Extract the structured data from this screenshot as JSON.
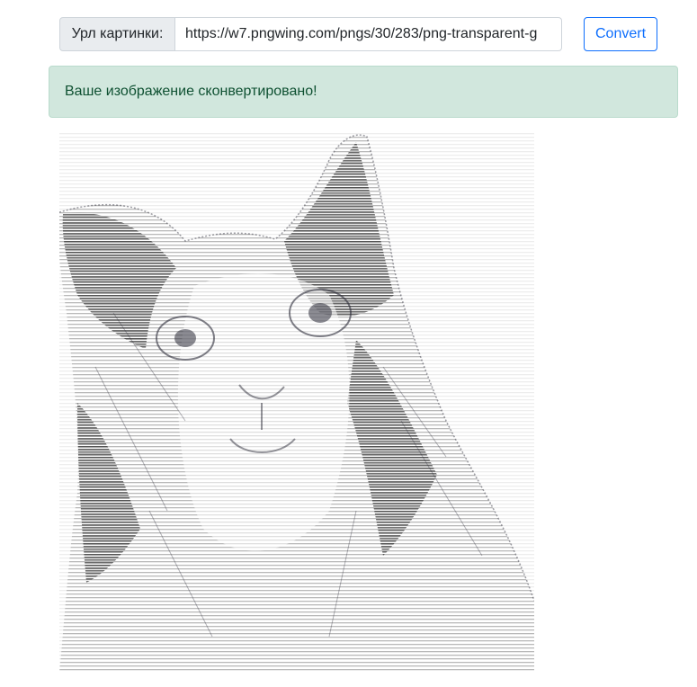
{
  "form": {
    "prefix_label": "Урл картинки:",
    "url_value": "https://w7.pngwing.com/pngs/30/283/png-transparent-g",
    "convert_label": "Convert"
  },
  "alert": {
    "message": "Ваше изображение сконвертировано!"
  },
  "result": {
    "image_name": "ascii-cat-image",
    "ink_color": "#2b2b38",
    "background_color": "#ffffff"
  },
  "colors": {
    "primary": "#0d6efd",
    "success_bg": "#d1e7dd",
    "success_text": "#0f5132"
  }
}
